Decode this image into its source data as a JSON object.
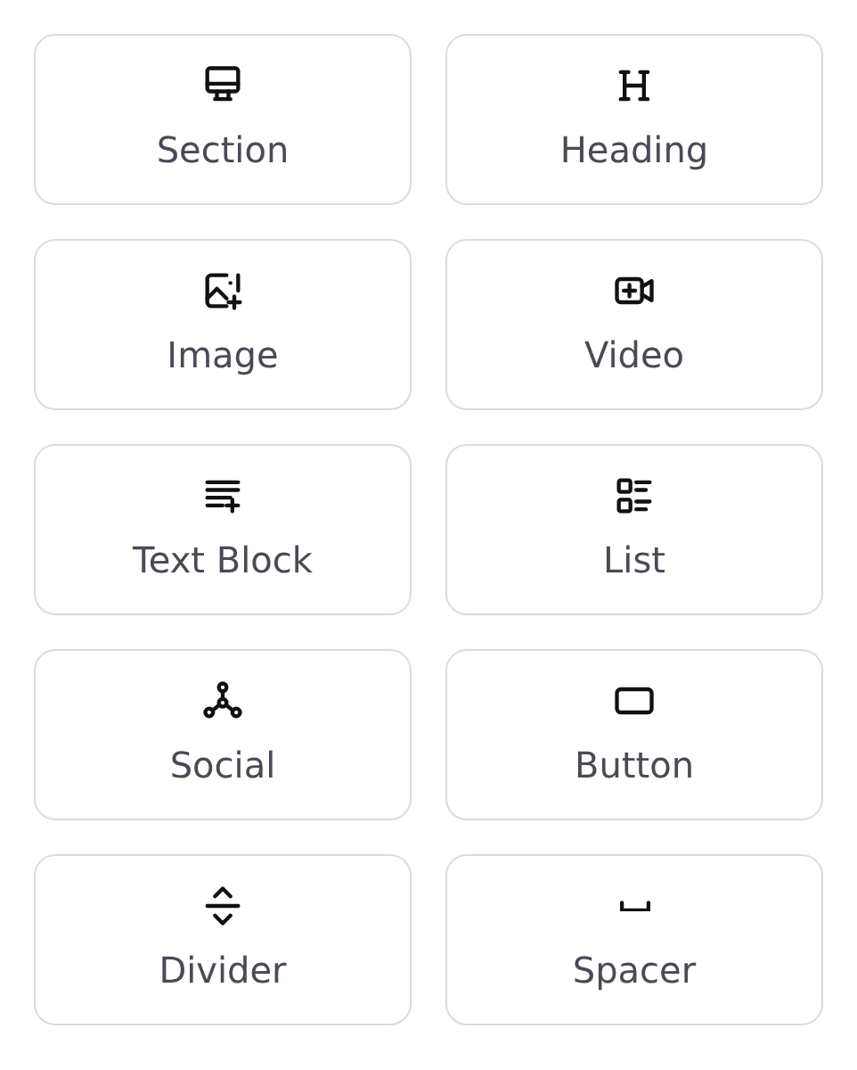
{
  "blocks": [
    {
      "kind": "section",
      "label": "Section"
    },
    {
      "kind": "heading",
      "label": "Heading"
    },
    {
      "kind": "image",
      "label": "Image"
    },
    {
      "kind": "video",
      "label": "Video"
    },
    {
      "kind": "text",
      "label": "Text Block"
    },
    {
      "kind": "list",
      "label": "List"
    },
    {
      "kind": "social",
      "label": "Social"
    },
    {
      "kind": "button",
      "label": "Button"
    },
    {
      "kind": "divider",
      "label": "Divider"
    },
    {
      "kind": "spacer",
      "label": "Spacer"
    }
  ]
}
